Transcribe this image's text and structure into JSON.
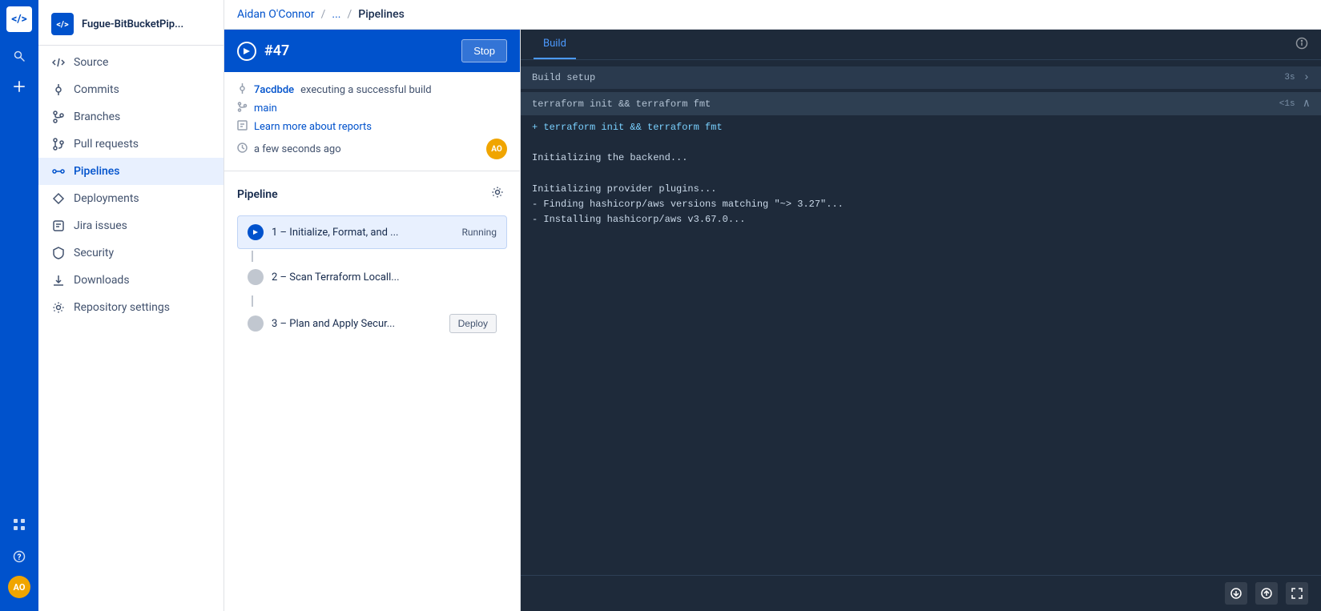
{
  "app": {
    "logo_text": "</>",
    "avatar_initials": "AO"
  },
  "sidebar": {
    "repo_name": "Fugue-BitBucketPip...",
    "items": [
      {
        "id": "source",
        "label": "Source",
        "icon": "code"
      },
      {
        "id": "commits",
        "label": "Commits",
        "icon": "commits"
      },
      {
        "id": "branches",
        "label": "Branches",
        "icon": "branches"
      },
      {
        "id": "pull-requests",
        "label": "Pull requests",
        "icon": "pull-requests"
      },
      {
        "id": "pipelines",
        "label": "Pipelines",
        "icon": "pipelines",
        "active": true
      },
      {
        "id": "deployments",
        "label": "Deployments",
        "icon": "deployments"
      },
      {
        "id": "jira-issues",
        "label": "Jira issues",
        "icon": "jira"
      },
      {
        "id": "security",
        "label": "Security",
        "icon": "security"
      },
      {
        "id": "downloads",
        "label": "Downloads",
        "icon": "downloads"
      },
      {
        "id": "repository-settings",
        "label": "Repository settings",
        "icon": "settings"
      }
    ]
  },
  "breadcrumb": {
    "user": "Aidan O'Connor",
    "sep1": "/",
    "middle": "...",
    "sep2": "/",
    "current": "Pipelines"
  },
  "run": {
    "number": "#47",
    "stop_label": "Stop",
    "commit_hash": "7acdbde",
    "commit_message": "executing a successful build",
    "branch": "main",
    "learn_more": "Learn more about reports",
    "timestamp": "a few seconds ago",
    "avatar_initials": "AO"
  },
  "pipeline": {
    "title": "Pipeline",
    "steps": [
      {
        "id": "step-1",
        "name": "1 – Initialize, Format, and ...",
        "status": "Running",
        "type": "running"
      },
      {
        "id": "step-2",
        "name": "2 – Scan Terraform Locall...",
        "status": "",
        "type": "pending"
      },
      {
        "id": "step-3",
        "name": "3 – Plan and Apply Secur...",
        "status": "Deploy",
        "type": "deploy"
      }
    ]
  },
  "build": {
    "tab_label": "Build",
    "section_title": "terraform init && terraform fmt",
    "section_time": "<1s",
    "outer_time": "3s",
    "log_lines": [
      "+ terraform init && terraform fmt",
      "",
      "Initializing the backend...",
      "",
      "Initializing provider plugins...",
      "- Finding hashicorp/aws versions matching \"~> 3.27\"...",
      "- Installing hashicorp/aws v3.67.0..."
    ]
  },
  "build_setup": {
    "label": "Build setup",
    "time": "3s"
  }
}
